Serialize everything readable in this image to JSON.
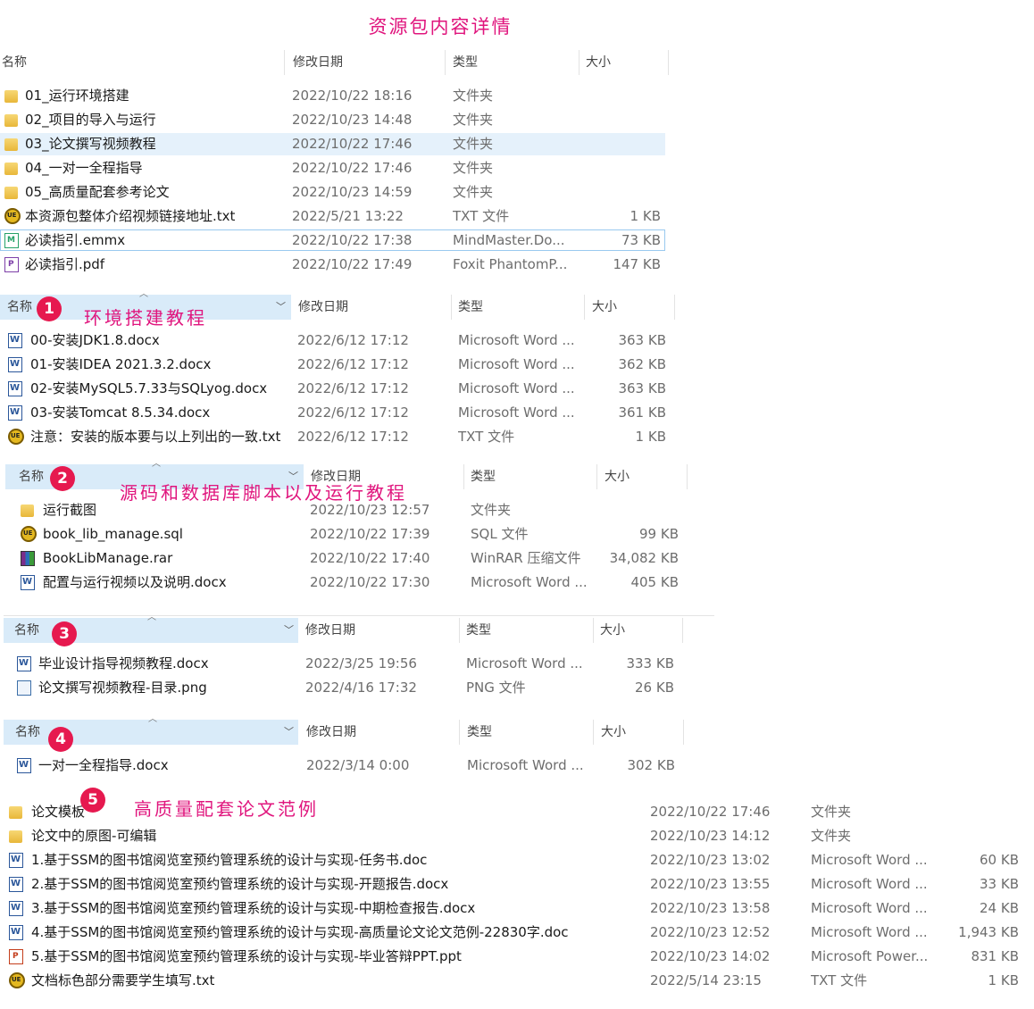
{
  "title": "资源包内容详情",
  "main": {
    "headers": {
      "name": "名称",
      "date": "修改日期",
      "type": "类型",
      "size": "大小"
    },
    "rows": [
      {
        "name": "01_运行环境搭建",
        "date": "2022/10/22 18:16",
        "type": "文件夹",
        "size": "",
        "icon": "folder-icon"
      },
      {
        "name": "02_项目的导入与运行",
        "date": "2022/10/23 14:48",
        "type": "文件夹",
        "size": "",
        "icon": "folder-icon"
      },
      {
        "name": "03_论文撰写视频教程",
        "date": "2022/10/22 17:46",
        "type": "文件夹",
        "size": "",
        "icon": "folder-icon"
      },
      {
        "name": "04_一对一全程指导",
        "date": "2022/10/22 17:46",
        "type": "文件夹",
        "size": "",
        "icon": "folder-icon"
      },
      {
        "name": "05_高质量配套参考论文",
        "date": "2022/10/23 14:59",
        "type": "文件夹",
        "size": "",
        "icon": "folder-icon"
      },
      {
        "name": "本资源包整体介绍视频链接地址.txt",
        "date": "2022/5/21 13:22",
        "type": "TXT 文件",
        "size": "1 KB",
        "icon": "txt-icon"
      },
      {
        "name": "必读指引.emmx",
        "date": "2022/10/22 17:38",
        "type": "MindMaster.Do...",
        "size": "73 KB",
        "icon": "mindmaster-icon"
      },
      {
        "name": "必读指引.pdf",
        "date": "2022/10/22 17:49",
        "type": "Foxit PhantomP...",
        "size": "147 KB",
        "icon": "pdf-icon"
      }
    ]
  },
  "sections": [
    {
      "badge": "1",
      "caption": "环境搭建教程",
      "rows": [
        {
          "name": "00-安装JDK1.8.docx",
          "date": "2022/6/12 17:12",
          "type": "Microsoft Word ...",
          "size": "363 KB",
          "icon": "word-icon"
        },
        {
          "name": "01-安装IDEA 2021.3.2.docx",
          "date": "2022/6/12 17:12",
          "type": "Microsoft Word ...",
          "size": "362 KB",
          "icon": "word-icon"
        },
        {
          "name": "02-安装MySQL5.7.33与SQLyog.docx",
          "date": "2022/6/12 17:12",
          "type": "Microsoft Word ...",
          "size": "363 KB",
          "icon": "word-icon"
        },
        {
          "name": "03-安装Tomcat 8.5.34.docx",
          "date": "2022/6/12 17:12",
          "type": "Microsoft Word ...",
          "size": "361 KB",
          "icon": "word-icon"
        },
        {
          "name": "注意：安装的版本要与以上列出的一致.txt",
          "date": "2022/6/12 17:12",
          "type": "TXT 文件",
          "size": "1 KB",
          "icon": "txt-icon"
        }
      ]
    },
    {
      "badge": "2",
      "caption": "源码和数据库脚本以及运行教程",
      "rows": [
        {
          "name": "运行截图",
          "date": "2022/10/23 12:57",
          "type": "文件夹",
          "size": "",
          "icon": "folder-icon"
        },
        {
          "name": "book_lib_manage.sql",
          "date": "2022/10/22 17:39",
          "type": "SQL 文件",
          "size": "99 KB",
          "icon": "txt-icon"
        },
        {
          "name": "BookLibManage.rar",
          "date": "2022/10/22 17:40",
          "type": "WinRAR 压缩文件",
          "size": "34,082 KB",
          "icon": "rar-icon"
        },
        {
          "name": "配置与运行视频以及说明.docx",
          "date": "2022/10/22 17:30",
          "type": "Microsoft Word ...",
          "size": "405 KB",
          "icon": "word-icon"
        }
      ]
    },
    {
      "badge": "3",
      "caption": "",
      "rows": [
        {
          "name": "毕业设计指导视频教程.docx",
          "date": "2022/3/25 19:56",
          "type": "Microsoft Word ...",
          "size": "333 KB",
          "icon": "word-icon"
        },
        {
          "name": "论文撰写视频教程-目录.png",
          "date": "2022/4/16 17:32",
          "type": "PNG 文件",
          "size": "26 KB",
          "icon": "png-icon"
        }
      ]
    },
    {
      "badge": "4",
      "caption": "",
      "rows": [
        {
          "name": "一对一全程指导.docx",
          "date": "2022/3/14 0:00",
          "type": "Microsoft Word ...",
          "size": "302 KB",
          "icon": "word-icon"
        }
      ]
    }
  ],
  "section5": {
    "badge": "5",
    "caption": "高质量配套论文范例",
    "rows": [
      {
        "name": "论文模板",
        "date": "2022/10/22 17:46",
        "type": "文件夹",
        "size": "",
        "icon": "folder-icon"
      },
      {
        "name": "论文中的原图-可编辑",
        "date": "2022/10/23 14:12",
        "type": "文件夹",
        "size": "",
        "icon": "folder-icon"
      },
      {
        "name": "1.基于SSM的图书馆阅览室预约管理系统的设计与实现-任务书.doc",
        "date": "2022/10/23 13:02",
        "type": "Microsoft Word ...",
        "size": "60 KB",
        "icon": "word-icon"
      },
      {
        "name": "2.基于SSM的图书馆阅览室预约管理系统的设计与实现-开题报告.docx",
        "date": "2022/10/23 13:55",
        "type": "Microsoft Word ...",
        "size": "33 KB",
        "icon": "word-icon"
      },
      {
        "name": "3.基于SSM的图书馆阅览室预约管理系统的设计与实现-中期检查报告.docx",
        "date": "2022/10/23 13:58",
        "type": "Microsoft Word ...",
        "size": "24 KB",
        "icon": "word-icon"
      },
      {
        "name": "4.基于SSM的图书馆阅览室预约管理系统的设计与实现-高质量论文论文范例-22830字.doc",
        "date": "2022/10/23 12:52",
        "type": "Microsoft Word ...",
        "size": "1,943 KB",
        "icon": "word-icon"
      },
      {
        "name": "5.基于SSM的图书馆阅览室预约管理系统的设计与实现-毕业答辩PPT.ppt",
        "date": "2022/10/23 14:02",
        "type": "Microsoft Power...",
        "size": "831 KB",
        "icon": "ppt-icon"
      },
      {
        "name": "文档标色部分需要学生填写.txt",
        "date": "2022/5/14 23:15",
        "type": "TXT 文件",
        "size": "1 KB",
        "icon": "txt-icon"
      }
    ]
  }
}
